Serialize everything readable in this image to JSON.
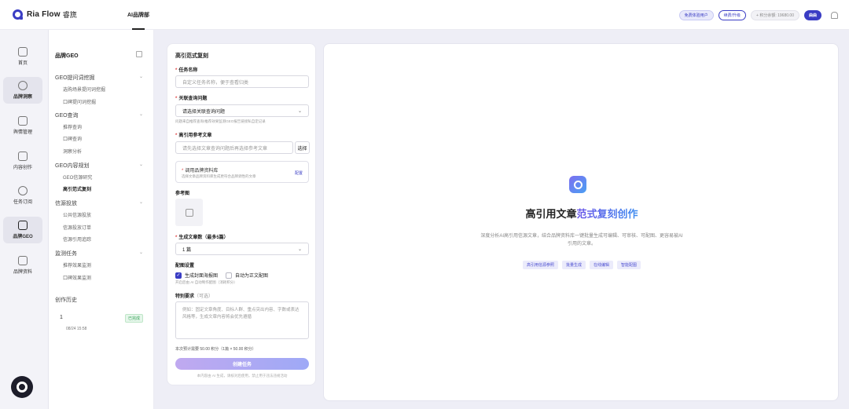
{
  "app": {
    "name": "Ria Flow",
    "sub": "睿旒"
  },
  "top_nav": {
    "active_tab": "AI品牌部"
  },
  "top_right": {
    "trial": "免费体验用户",
    "renew": "续费/升级",
    "credits": "+ 积分余额: 19680.00",
    "user": "曲曲"
  },
  "rail": {
    "items": [
      {
        "label": "首页"
      },
      {
        "label": "品牌洞察"
      },
      {
        "label": "舆情管理"
      },
      {
        "label": "内容创作"
      },
      {
        "label": "任务订阅"
      },
      {
        "label": "品牌GEO"
      },
      {
        "label": "品牌资料"
      }
    ]
  },
  "menu": {
    "title": "品牌GEO",
    "groups": [
      {
        "label": "GEO提问词挖掘",
        "items": [
          "选购场景提问词挖掘",
          "口碑提问词挖掘"
        ]
      },
      {
        "label": "GEO查询",
        "items": [
          "推荐查询",
          "口碑查询",
          "洞察分析"
        ]
      },
      {
        "label": "GEO内容规划",
        "items": [
          "GEO信源研究",
          "高引范式复刻"
        ]
      },
      {
        "label": "信源投放",
        "items": [
          "公共信源投放",
          "信源投放订单",
          "信源引用追踪"
        ]
      },
      {
        "label": "监测任务",
        "items": [
          "推荐效果监测",
          "口碑效果监测"
        ]
      }
    ],
    "history": {
      "title": "创作历史",
      "row": {
        "num": "1",
        "badge": "已完成",
        "time": "08/24 15:58"
      }
    }
  },
  "form": {
    "title": "高引范式复刻",
    "task_name": {
      "label": "任务名称",
      "placeholder": "自定义任务名称，便于查看归类"
    },
    "question": {
      "label": "关联查询问题",
      "value": "请选择关联查询问题",
      "hint": "问题来自推荐查询/推荐效果监测GEO报告链接私自定记录"
    },
    "ref_article": {
      "label": "高引用参考文章",
      "placeholder": "请先选择文章查询问题后再选择参考文章",
      "button": "选择"
    },
    "library": {
      "title": "调用品牌资料库",
      "desc": "选择文章品牌资料库生成更符合品牌调性的文章",
      "config": "配置"
    },
    "ref_image": {
      "label": "参考图"
    },
    "count": {
      "label": "生成文章数（最多5篇）",
      "value": "1 篇"
    },
    "image_settings": {
      "label": "配图设置",
      "opt1": "生成封面海报图",
      "opt2": "自动为正文配图",
      "hint": "开启后由 AI 自动制作配图（消耗积分）"
    },
    "special": {
      "label": "特别要求",
      "optional": "（可选）",
      "placeholder": "例如：固定文章角度、目标人群、重点突出内容、字数或表达风格等，生成文章内容将会优先遵循"
    },
    "cost": "本次预计需要 50.00 积分（1篇 × 50.00 积分）",
    "submit": "创建任务",
    "footer": "本内容由 AI 生成，请核对后使用，禁止用于违法违规活动"
  },
  "preview": {
    "title_plain": "高引用文章",
    "title_accent": "范式复刻创作",
    "desc": "深度分析AI高引用信源文章，结合品牌资料库一键批量生成可编辑、可审核、可配图、更容易被AI引用的文章。",
    "tags": [
      "高引用信源参照",
      "批量生成",
      "在线编辑",
      "智能配图"
    ]
  }
}
